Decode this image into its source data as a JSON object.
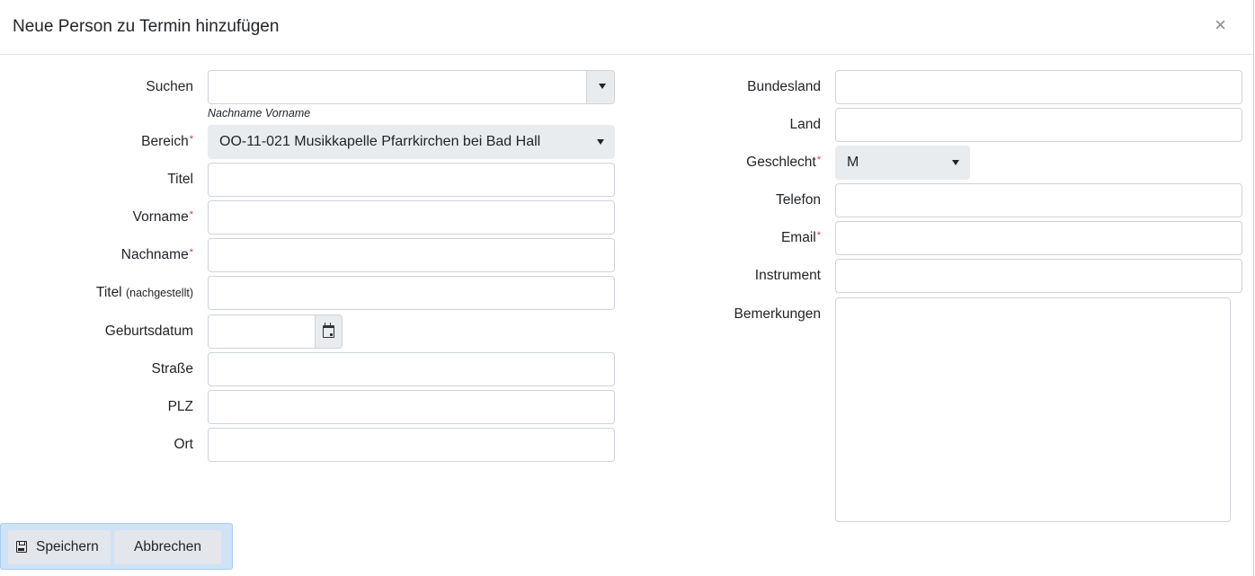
{
  "dialog": {
    "title": "Neue Person zu Termin hinzufügen",
    "close_symbol": "×"
  },
  "left": {
    "search": {
      "label": "Suchen",
      "value": "",
      "hint": "Nachname Vorname"
    },
    "bereich": {
      "label": "Bereich",
      "required": "*",
      "value": "OO-11-021 Musikkapelle Pfarrkirchen bei Bad Hall"
    },
    "titel": {
      "label": "Titel",
      "value": ""
    },
    "vorname": {
      "label": "Vorname",
      "required": "*",
      "value": ""
    },
    "nachname": {
      "label": "Nachname",
      "required": "*",
      "value": ""
    },
    "titel_nach": {
      "label": "Titel",
      "label_suffix": "(nachgestellt)",
      "value": ""
    },
    "geburtsdatum": {
      "label": "Geburtsdatum",
      "value": ""
    },
    "strasse": {
      "label": "Straße",
      "value": ""
    },
    "plz": {
      "label": "PLZ",
      "value": ""
    },
    "ort": {
      "label": "Ort",
      "value": ""
    }
  },
  "right": {
    "bundesland": {
      "label": "Bundesland",
      "value": ""
    },
    "land": {
      "label": "Land",
      "value": ""
    },
    "geschlecht": {
      "label": "Geschlecht",
      "required": "*",
      "value": "M"
    },
    "telefon": {
      "label": "Telefon",
      "value": ""
    },
    "email": {
      "label": "Email",
      "required": "*",
      "value": ""
    },
    "instrument": {
      "label": "Instrument",
      "value": ""
    },
    "bemerkungen": {
      "label": "Bemerkungen",
      "value": ""
    }
  },
  "footer": {
    "save_label": "Speichern",
    "cancel_label": "Abbrechen"
  },
  "icons": {
    "save": "save-icon",
    "calendar": "calendar-icon",
    "caret": "caret-down-icon",
    "close": "close-icon"
  },
  "colors": {
    "required": "#dc3545",
    "footer_bg": "#cfe2f6",
    "select_bg": "#e9ecef"
  }
}
